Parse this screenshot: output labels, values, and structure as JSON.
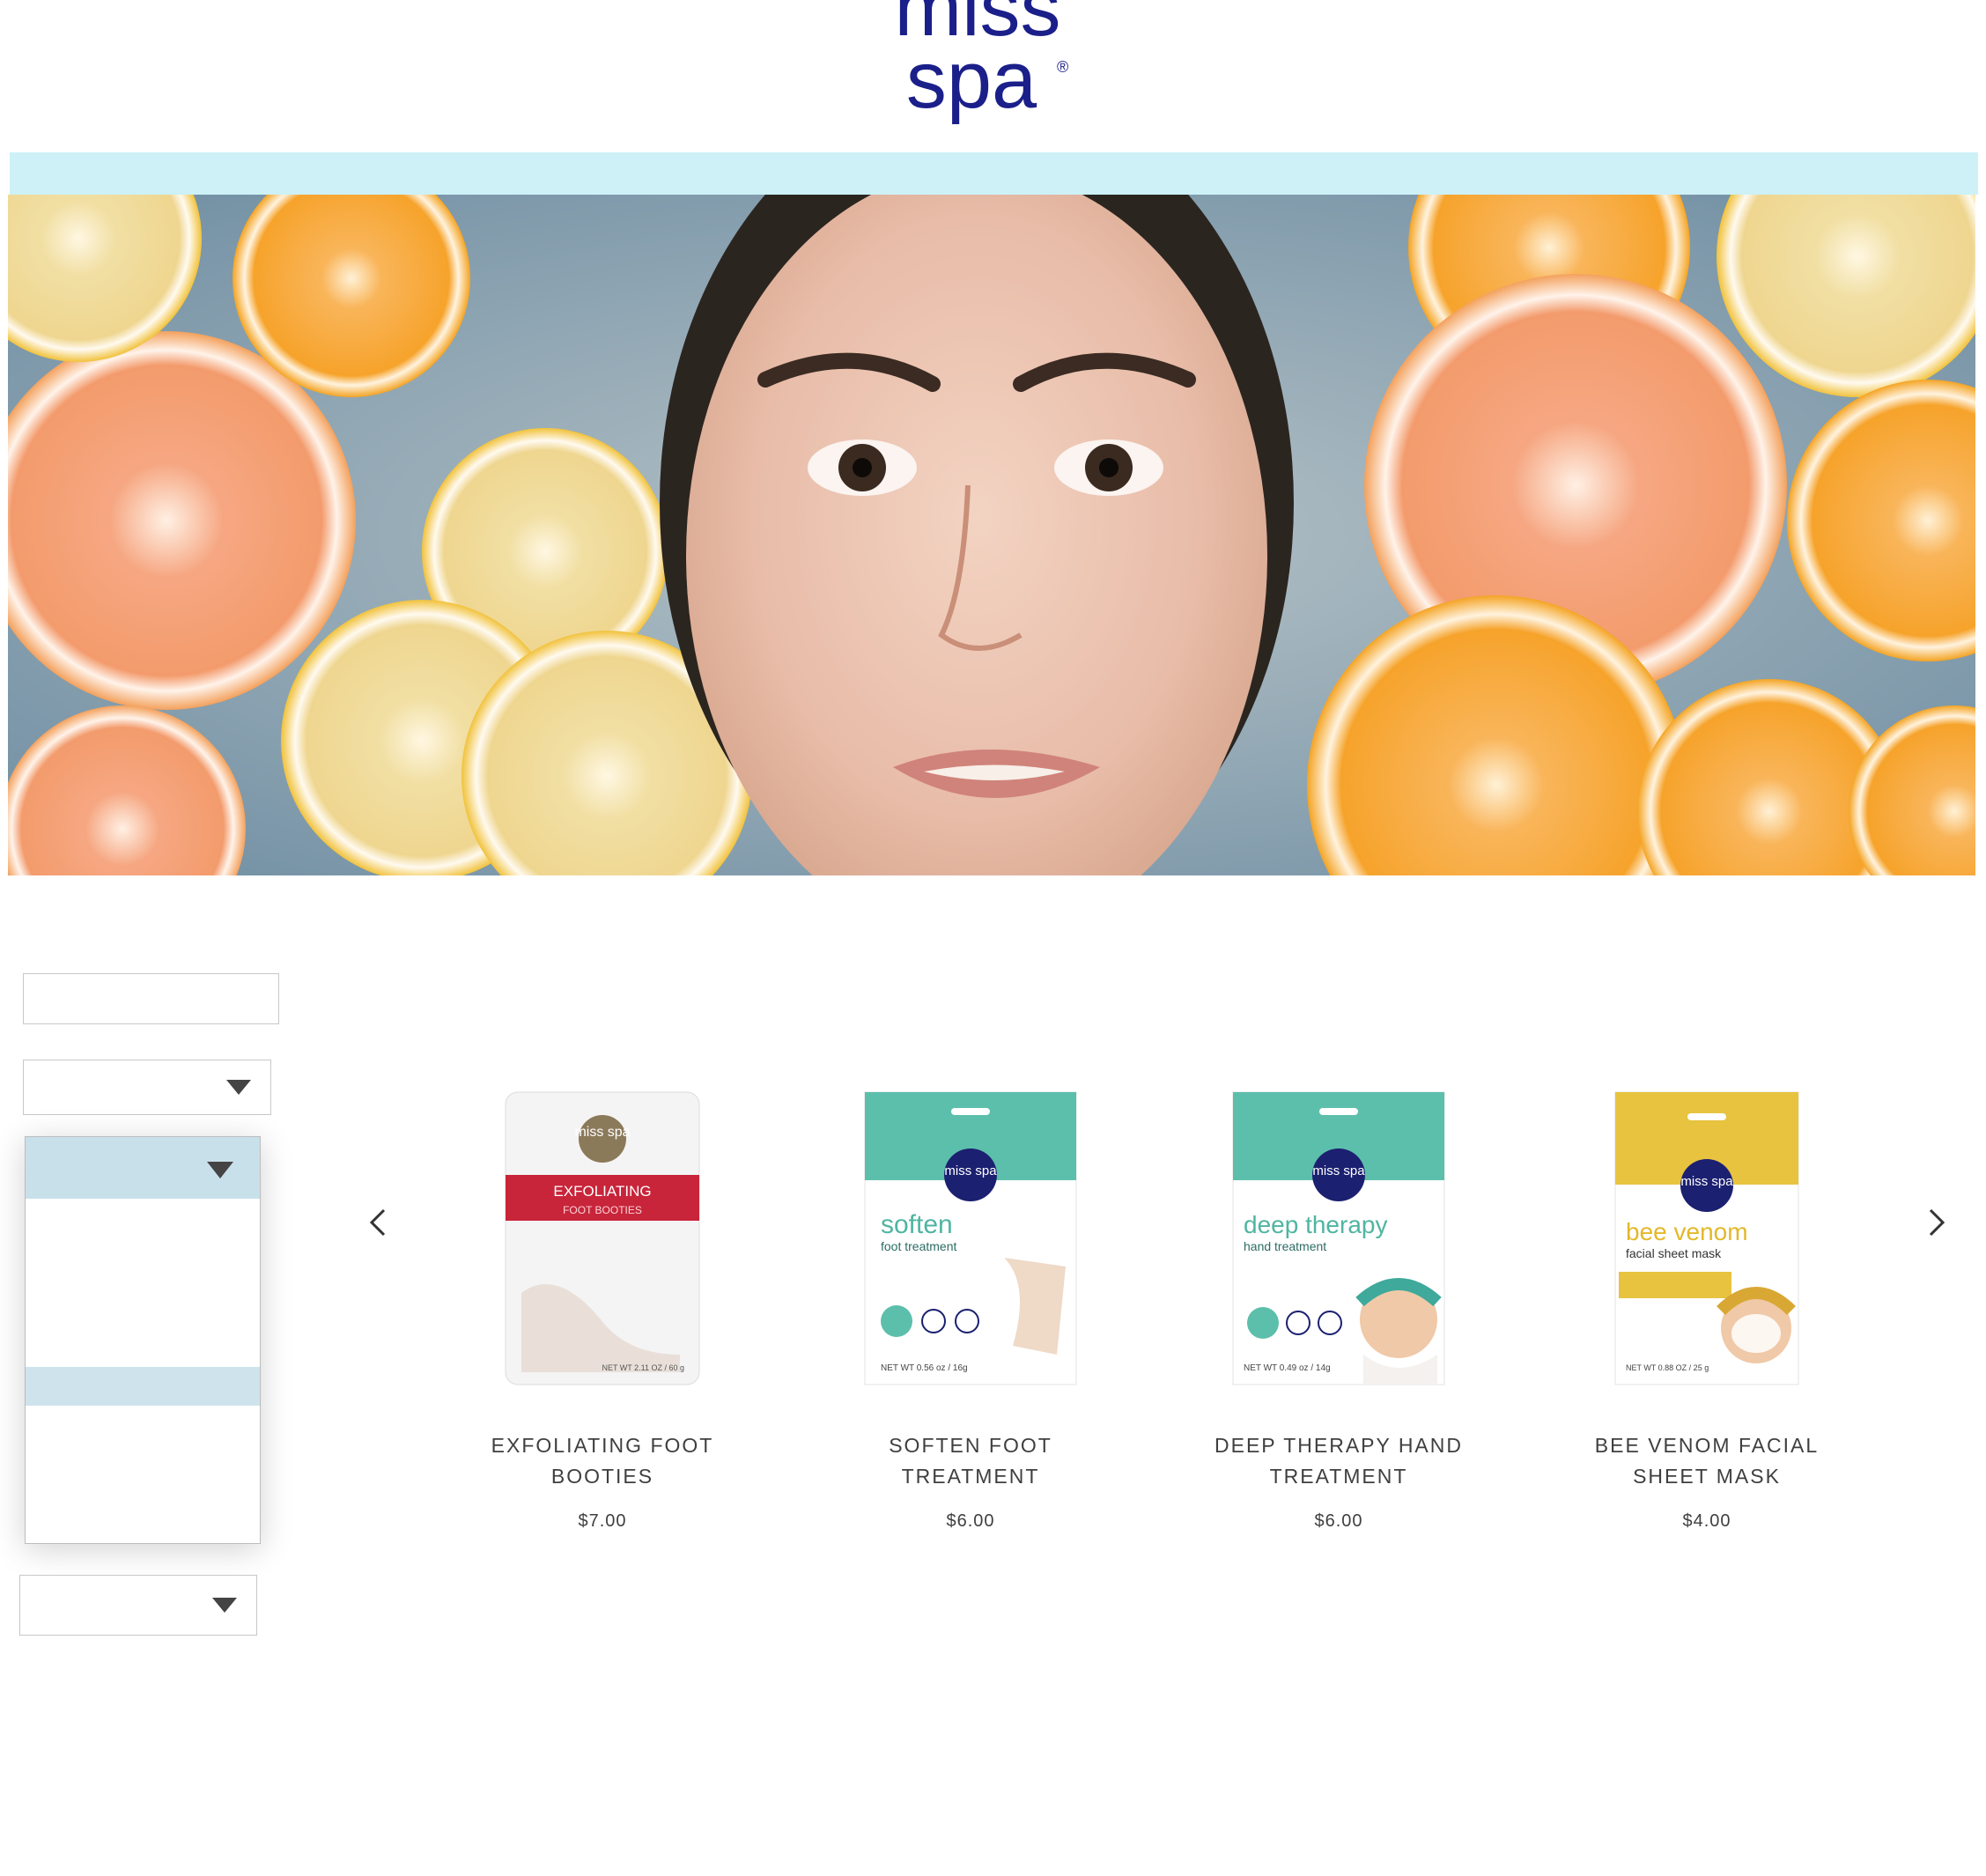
{
  "brand": {
    "logo_line1": "miss",
    "logo_line2": "spa",
    "logo_mark": "®",
    "logo_color": "#1b1f8a",
    "nav_bar_color": "#cdf1f7"
  },
  "hero": {
    "image_description_icon": "hero-photo"
  },
  "filters": {
    "search_value": "",
    "select_1_value": "",
    "select_2_value": "",
    "select_3_value": ""
  },
  "carousel": {
    "prev_icon": "chevron-left-icon",
    "next_icon": "chevron-right-icon",
    "products": [
      {
        "title": "EXFOLIATING FOOT BOOTIES",
        "price": "$7.00",
        "pack_brand": "miss spa",
        "pack_name": "EXFOLIATING",
        "pack_sub": "FOOT BOOTIES",
        "pack_weight": "NET WT 2.11 OZ / 60 g",
        "accent": "#c8243a"
      },
      {
        "title": "SOFTEN FOOT TREATMENT",
        "price": "$6.00",
        "pack_brand": "miss spa",
        "pack_name": "soften",
        "pack_sub": "foot treatment",
        "pack_weight": "NET WT 0.56 oz / 16g",
        "accent": "#5cbfab"
      },
      {
        "title": "DEEP THERAPY HAND TREATMENT",
        "price": "$6.00",
        "pack_brand": "miss spa",
        "pack_name": "deep therapy",
        "pack_sub": "hand treatment",
        "pack_weight": "NET WT 0.49 oz / 14g",
        "accent": "#5cbfab"
      },
      {
        "title": "BEE VENOM FACIAL SHEET MASK",
        "price": "$4.00",
        "pack_brand": "miss spa",
        "pack_name": "bee venom",
        "pack_sub": "facial sheet mask",
        "pack_weight": "NET WT 0.88 OZ / 25 g",
        "accent": "#e7c33f"
      }
    ]
  }
}
